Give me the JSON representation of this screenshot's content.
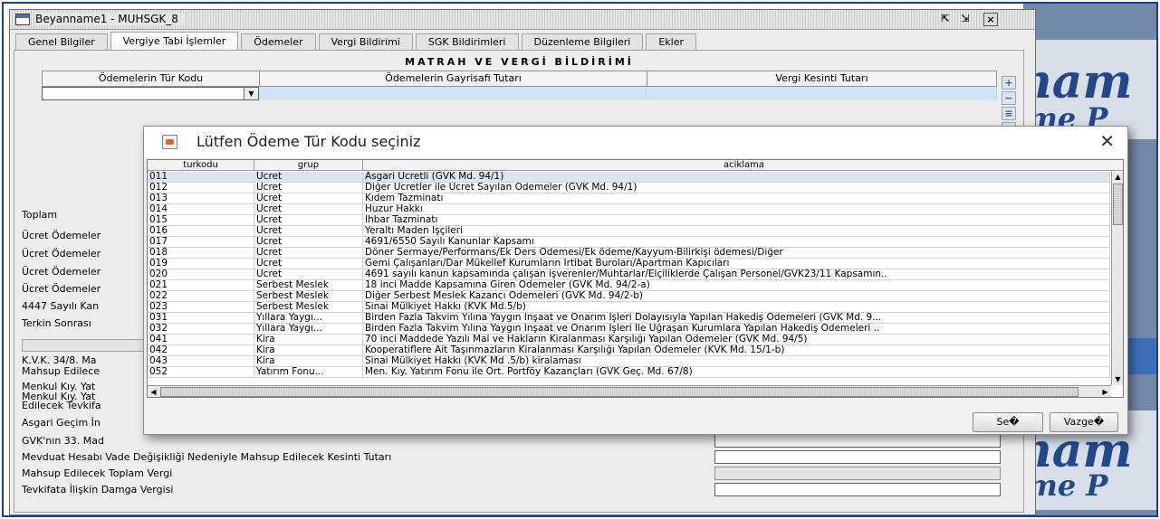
{
  "window": {
    "title": "Beyanname1 - MUHSGK_8",
    "tabs": [
      {
        "label": "Genel Bilgiler"
      },
      {
        "label": "Vergiye Tabi İşlemler"
      },
      {
        "label": "Ödemeler"
      },
      {
        "label": "Vergi Bildirimi"
      },
      {
        "label": "SGK Bildirimleri"
      },
      {
        "label": "Düzenleme Bilgileri"
      },
      {
        "label": "Ekler"
      }
    ],
    "active_tab": "Vergiye Tabi İşlemler"
  },
  "section": {
    "title": "MATRAH VE VERGİ BİLDİRİMİ",
    "columns": [
      "Ödemelerin Tür Kodu",
      "Ödemelerin Gayrisafi Tutarı",
      "Vergi Kesinti Tutarı"
    ]
  },
  "form_labels": [
    "Toplam",
    "Ücret Ödemeler",
    "Ücret Ödemeler",
    "Ücret Ödemeler",
    "Ücret Ödemeler",
    "4447 Sayılı Kan",
    "Terkin Sonrası",
    "K.V.K. 34/8. Ma",
    "Mahsup Edilece",
    "Menkul Kıy. Yat",
    "Menkul Kıy. Yat",
    "Edilecek Tevkifa",
    "Asgari Geçim İn",
    "GVK'nın 33. Mad",
    "Mevduat Hesabı Vade Değişikliği Nedeniyle Mahsup Edilecek Kesinti Tutarı",
    "Mahsup Edilecek Toplam Vergi",
    "Tevkifata İlişkin Damga Vergisi"
  ],
  "background_app": {
    "text1": "nam",
    "text2": "me P",
    "text3": "nam",
    "text4": "me P"
  },
  "dialog": {
    "title": "Lütfen Ödeme Tür Kodu seçiniz",
    "columns": [
      "turkodu",
      "grup",
      "aciklama"
    ],
    "rows": [
      {
        "kod": "011",
        "grup": "Ücret",
        "aciklama": "Asgari Ücretli (GVK Md. 94/1)"
      },
      {
        "kod": "012",
        "grup": "Ücret",
        "aciklama": "Diğer Ücretler ile Ücret Sayılan Ödemeler (GVK Md. 94/1)"
      },
      {
        "kod": "013",
        "grup": "Ücret",
        "aciklama": "Kıdem Tazminatı"
      },
      {
        "kod": "014",
        "grup": "Ücret",
        "aciklama": "Huzur Hakkı"
      },
      {
        "kod": "015",
        "grup": "Ücret",
        "aciklama": "İhbar Tazminatı"
      },
      {
        "kod": "016",
        "grup": "Ücret",
        "aciklama": "Yeraltı Maden İşçileri"
      },
      {
        "kod": "017",
        "grup": "Ücret",
        "aciklama": "4691/6550 Sayılı Kanunlar Kapsamı"
      },
      {
        "kod": "018",
        "grup": "Ücret",
        "aciklama": "Döner Sermaye/Performans/Ek Ders Odemesi/Ek ödeme/Kayyum-Bilirkişi ödemesi/Diğer"
      },
      {
        "kod": "019",
        "grup": "Ücret",
        "aciklama": "Gemi Çalışanları/Dar Mükellef Kurumların İrtibat Buroları/Apartman Kapıcıları"
      },
      {
        "kod": "020",
        "grup": "Ücret",
        "aciklama": "4691 sayılı kanun kapsamında çalışan işverenler/Muhtarlar/Elçiliklerde Çalışan Personel/GVK23/11 Kapsamın.."
      },
      {
        "kod": "021",
        "grup": "Serbest Meslek",
        "aciklama": "18 inci Madde Kapsamına Giren Ödemeler (GVK Md. 94/2-a)"
      },
      {
        "kod": "022",
        "grup": "Serbest Meslek",
        "aciklama": "Diğer Serbest Meslek Kazancı Ödemeleri (GVK Md. 94/2-b)"
      },
      {
        "kod": "023",
        "grup": "Serbest Meslek",
        "aciklama": "Sinai Mülkiyet Hakkı (KVK Md.5/b)"
      },
      {
        "kod": "031",
        "grup": "Yıllara Yaygı...",
        "aciklama": "Birden Fazla Takvim Yılına Yaygın İnşaat ve Onarım İşleri Dolayısıyla Yapılan Hakediş Ödemeleri (GVK Md. 9..."
      },
      {
        "kod": "032",
        "grup": "Yıllara Yaygı...",
        "aciklama": "Birden Fazla Takvim Yılına Yaygın İnşaat ve Onarım İşleri İle Uğraşan Kurumlara Yapılan Hakediş Ödemeleri .."
      },
      {
        "kod": "041",
        "grup": "Kira",
        "aciklama": "70 inci Maddede Yazılı Mal ve Hakların Kiralanması Karşılığı Yapılan Ödemeler (GVK Md. 94/5)"
      },
      {
        "kod": "042",
        "grup": "Kira",
        "aciklama": "Kooperatiflere Ait Taşınmazların Kiralanması Karşılığı Yapılan Ödemeler (KVK Md. 15/1-b)"
      },
      {
        "kod": "043",
        "grup": "Kira",
        "aciklama": "Sinai Mülkiyet Hakkı (KVK Md .5/b) kiralaması"
      },
      {
        "kod": "052",
        "grup": "Yatırım Fonu...",
        "aciklama": "Men. Kıy. Yatırım Fonu ile Ort. Portföy Kazançları (GVK Geç. Md. 67/8)"
      }
    ],
    "select_label": "Se�",
    "cancel_label": "Vazge�"
  }
}
